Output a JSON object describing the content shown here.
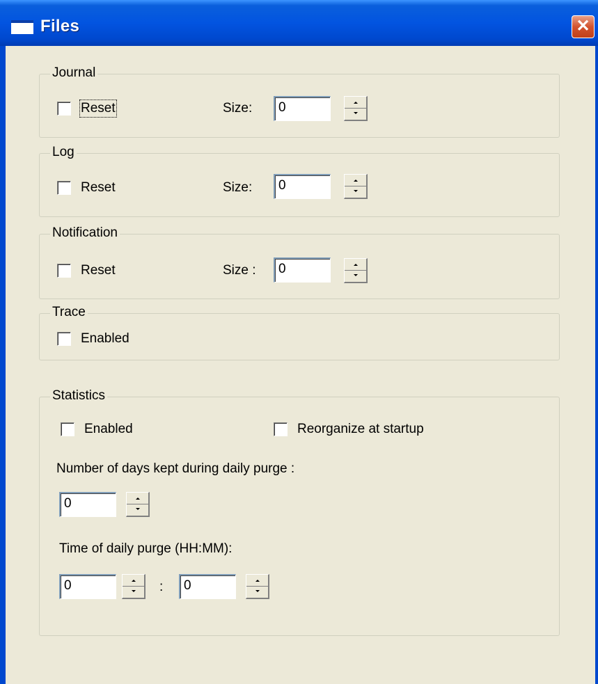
{
  "window": {
    "title": "Files",
    "close_glyph": "✕"
  },
  "journal": {
    "legend": "Journal",
    "reset_label": "Reset",
    "size_label": "Size:",
    "size_value": "0"
  },
  "log": {
    "legend": "Log",
    "reset_label": "Reset",
    "size_label": "Size:",
    "size_value": "0"
  },
  "notification": {
    "legend": "Notification",
    "reset_label": "Reset",
    "size_label": "Size :",
    "size_value": "0"
  },
  "trace": {
    "legend": "Trace",
    "enabled_label": "Enabled"
  },
  "statistics": {
    "legend": "Statistics",
    "enabled_label": "Enabled",
    "reorganize_label": "Reorganize at startup",
    "days_label": "Number of days kept during daily purge :",
    "days_value": "0",
    "time_label": "Time of daily purge (HH:MM):",
    "hours_value": "0",
    "separator": ":",
    "minutes_value": "0"
  }
}
